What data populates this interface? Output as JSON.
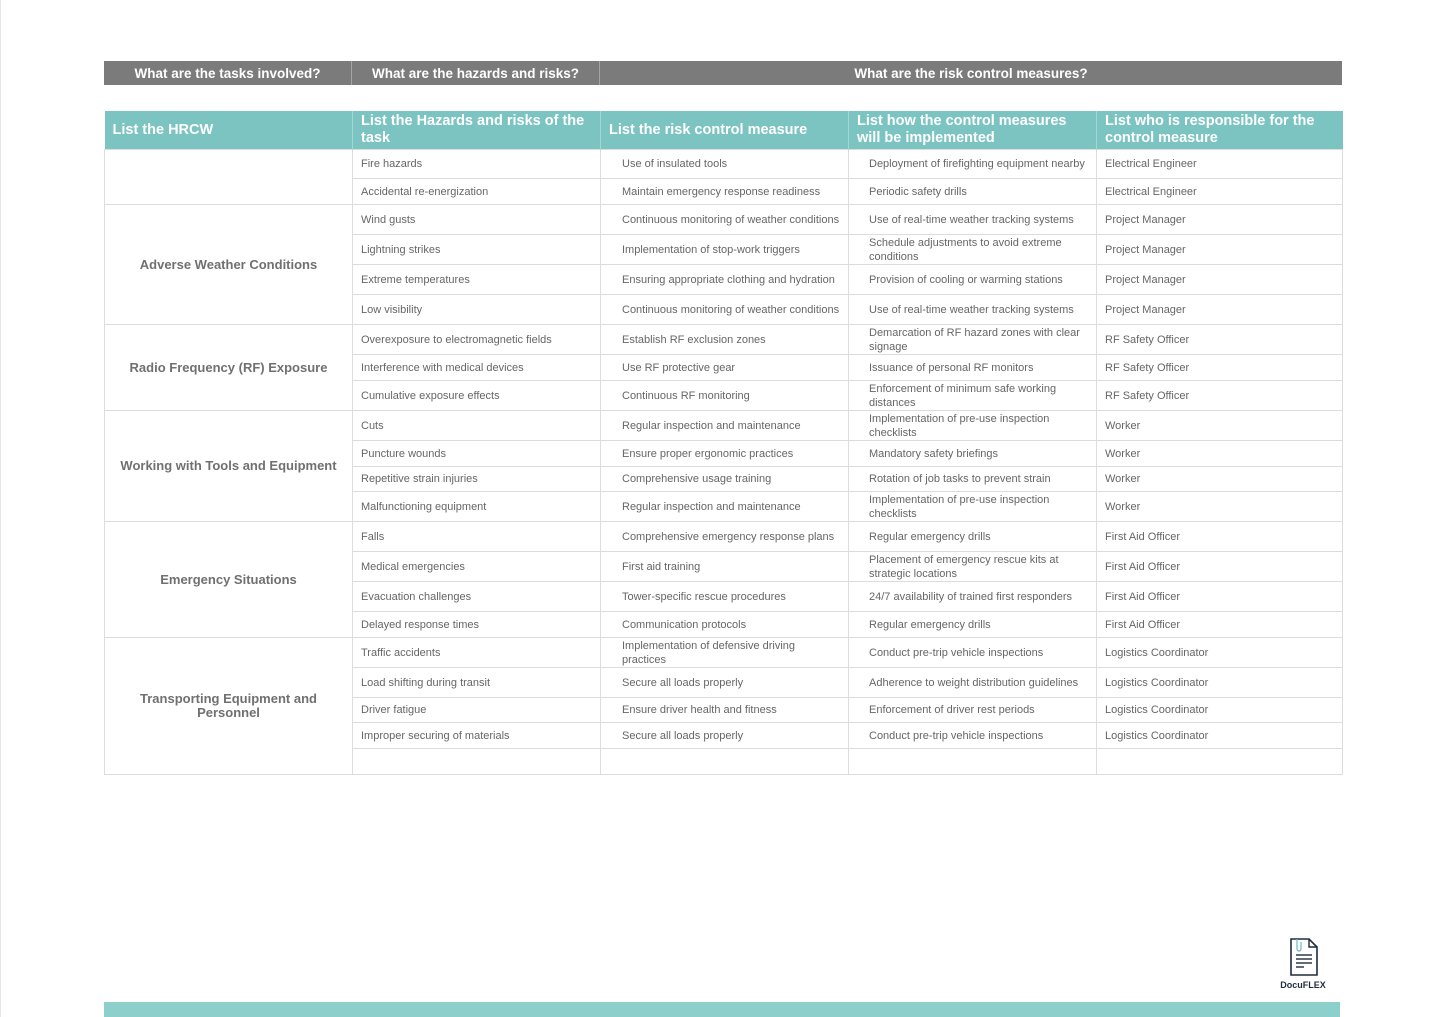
{
  "top_headers": [
    "What are the tasks involved?",
    "What are the hazards and risks?",
    "What are the risk control measures?"
  ],
  "column_headers": [
    "List the HRCW",
    "List the Hazards and risks of the task",
    "List the risk control measure",
    "List how the control measures will be implemented",
    "List who is responsible for the control measure"
  ],
  "groups": [
    {
      "task": "",
      "rows": [
        {
          "hazard": "Fire hazards",
          "control": "Use of insulated tools",
          "implementation": "Deployment of firefighting equipment nearby",
          "responsible": "Electrical Engineer"
        },
        {
          "hazard": "Accidental re-energization",
          "control": "Maintain emergency response readiness",
          "implementation": "Periodic safety drills",
          "responsible": "Electrical Engineer"
        }
      ]
    },
    {
      "task": "Adverse Weather Conditions",
      "rows": [
        {
          "hazard": "Wind gusts",
          "control": "Continuous monitoring of weather conditions",
          "implementation": "Use of real-time weather tracking systems",
          "responsible": "Project Manager"
        },
        {
          "hazard": "Lightning strikes",
          "control": "Implementation of stop-work triggers",
          "implementation": "Schedule adjustments to avoid extreme conditions",
          "responsible": "Project Manager"
        },
        {
          "hazard": "Extreme temperatures",
          "control": "Ensuring appropriate clothing and hydration",
          "implementation": "Provision of cooling or warming stations",
          "responsible": "Project Manager"
        },
        {
          "hazard": "Low visibility",
          "control": "Continuous monitoring of weather conditions",
          "implementation": "Use of real-time weather tracking systems",
          "responsible": "Project Manager"
        }
      ]
    },
    {
      "task": "Radio Frequency (RF) Exposure",
      "rows": [
        {
          "hazard": "Overexposure to electromagnetic fields",
          "control": "Establish RF exclusion zones",
          "implementation": "Demarcation of RF hazard zones with clear signage",
          "responsible": "RF Safety Officer"
        },
        {
          "hazard": "Interference with medical devices",
          "control": "Use RF protective gear",
          "implementation": "Issuance of personal RF monitors",
          "responsible": "RF Safety Officer"
        },
        {
          "hazard": "Cumulative exposure effects",
          "control": "Continuous RF monitoring",
          "implementation": "Enforcement of minimum safe working distances",
          "responsible": "RF Safety Officer"
        }
      ]
    },
    {
      "task": "Working with Tools and Equipment",
      "rows": [
        {
          "hazard": "Cuts",
          "control": "Regular inspection and maintenance",
          "implementation": "Implementation of pre-use inspection checklists",
          "responsible": "Worker"
        },
        {
          "hazard": "Puncture wounds",
          "control": "Ensure proper ergonomic practices",
          "implementation": "Mandatory safety briefings",
          "responsible": "Worker"
        },
        {
          "hazard": "Repetitive strain injuries",
          "control": "Comprehensive usage training",
          "implementation": "Rotation of job tasks to prevent strain",
          "responsible": "Worker"
        },
        {
          "hazard": "Malfunctioning equipment",
          "control": "Regular inspection and maintenance",
          "implementation": "Implementation of pre-use inspection checklists",
          "responsible": "Worker"
        }
      ]
    },
    {
      "task": "Emergency Situations",
      "rows": [
        {
          "hazard": "Falls",
          "control": "Comprehensive emergency response plans",
          "implementation": "Regular emergency drills",
          "responsible": "First Aid Officer"
        },
        {
          "hazard": "Medical emergencies",
          "control": "First aid training",
          "implementation": "Placement of emergency rescue kits at strategic locations",
          "responsible": "First Aid Officer"
        },
        {
          "hazard": "Evacuation challenges",
          "control": "Tower-specific rescue procedures",
          "implementation": "24/7 availability of trained first responders",
          "responsible": "First Aid Officer"
        },
        {
          "hazard": "Delayed response times",
          "control": "Communication protocols",
          "implementation": "Regular emergency drills",
          "responsible": "First Aid Officer"
        }
      ]
    },
    {
      "task": "Transporting Equipment and Personnel",
      "rows": [
        {
          "hazard": "Traffic accidents",
          "control": "Implementation of defensive driving practices",
          "implementation": "Conduct pre-trip vehicle inspections",
          "responsible": "Logistics Coordinator"
        },
        {
          "hazard": "Load shifting during transit",
          "control": "Secure all loads properly",
          "implementation": "Adherence to weight distribution guidelines",
          "responsible": "Logistics Coordinator"
        },
        {
          "hazard": "Driver fatigue",
          "control": "Ensure driver health and fitness",
          "implementation": "Enforcement of driver rest periods",
          "responsible": "Logistics Coordinator"
        },
        {
          "hazard": "Improper securing of materials",
          "control": "Secure all loads properly",
          "implementation": "Conduct pre-trip vehicle inspections",
          "responsible": "Logistics Coordinator"
        },
        {
          "hazard": "",
          "control": "",
          "implementation": "",
          "responsible": ""
        }
      ]
    }
  ],
  "logo": {
    "name": "DocuFLEX",
    "icon": "document-icon"
  },
  "colors": {
    "top_header_bg": "#7b7b7b",
    "column_header_bg": "#7cc4c2",
    "footer_bar": "#8ccfcb"
  }
}
